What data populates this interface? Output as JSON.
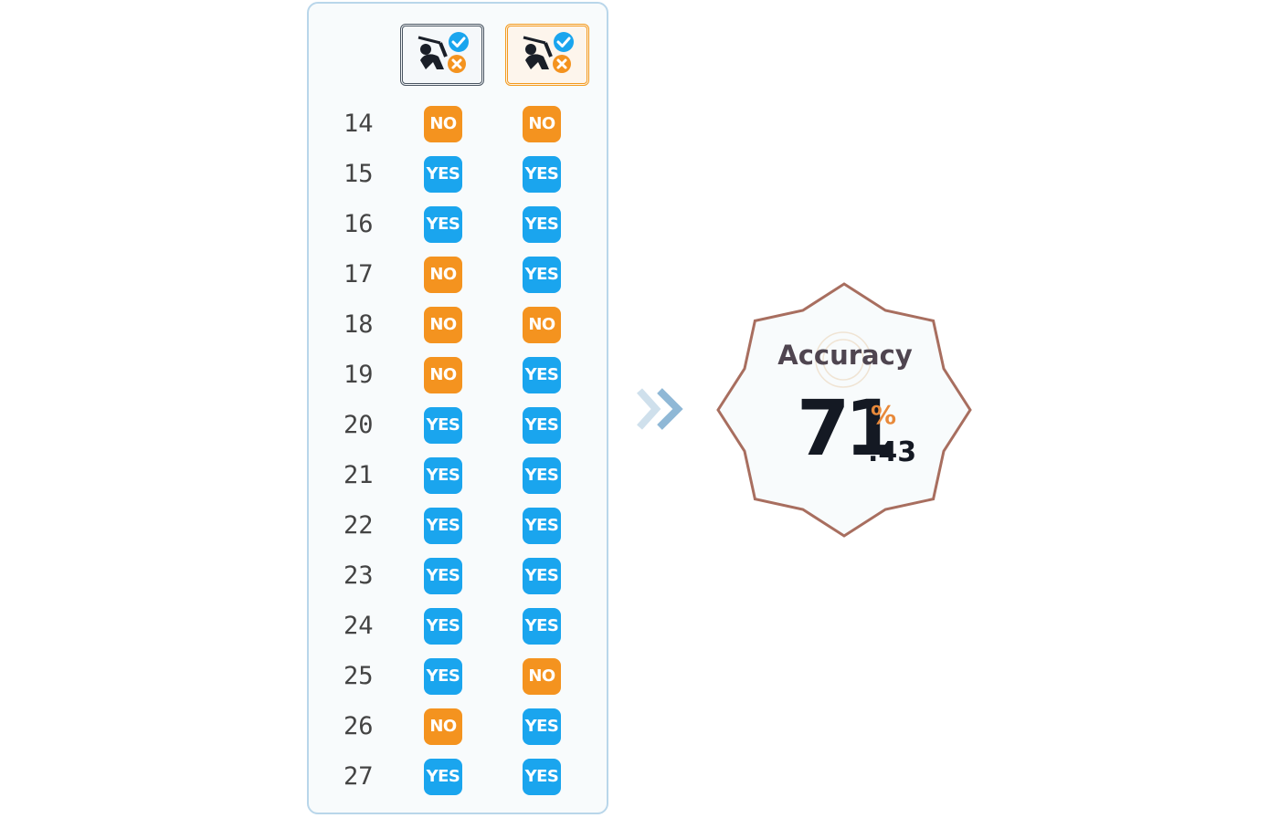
{
  "columns": [
    {
      "icon": "golfer-yes-no-icon",
      "frame_color": "#4a5561"
    },
    {
      "icon": "golfer-yes-no-icon",
      "frame_color": "#f39a1e"
    }
  ],
  "rows": [
    {
      "num": "14",
      "values": [
        "NO",
        "NO"
      ]
    },
    {
      "num": "15",
      "values": [
        "YES",
        "YES"
      ]
    },
    {
      "num": "16",
      "values": [
        "YES",
        "YES"
      ]
    },
    {
      "num": "17",
      "values": [
        "NO",
        "YES"
      ]
    },
    {
      "num": "18",
      "values": [
        "NO",
        "NO"
      ]
    },
    {
      "num": "19",
      "values": [
        "NO",
        "YES"
      ]
    },
    {
      "num": "20",
      "values": [
        "YES",
        "YES"
      ]
    },
    {
      "num": "21",
      "values": [
        "YES",
        "YES"
      ]
    },
    {
      "num": "22",
      "values": [
        "YES",
        "YES"
      ]
    },
    {
      "num": "23",
      "values": [
        "YES",
        "YES"
      ]
    },
    {
      "num": "24",
      "values": [
        "YES",
        "YES"
      ]
    },
    {
      "num": "25",
      "values": [
        "YES",
        "NO"
      ]
    },
    {
      "num": "26",
      "values": [
        "NO",
        "YES"
      ]
    },
    {
      "num": "27",
      "values": [
        "YES",
        "YES"
      ]
    }
  ],
  "colors": {
    "yes": "#1aa5ee",
    "no": "#f4931f",
    "octagon_border": "#a86e5f"
  },
  "accuracy": {
    "label": "Accuracy",
    "integer": "71",
    "percent": "%",
    "decimal": ".43"
  }
}
